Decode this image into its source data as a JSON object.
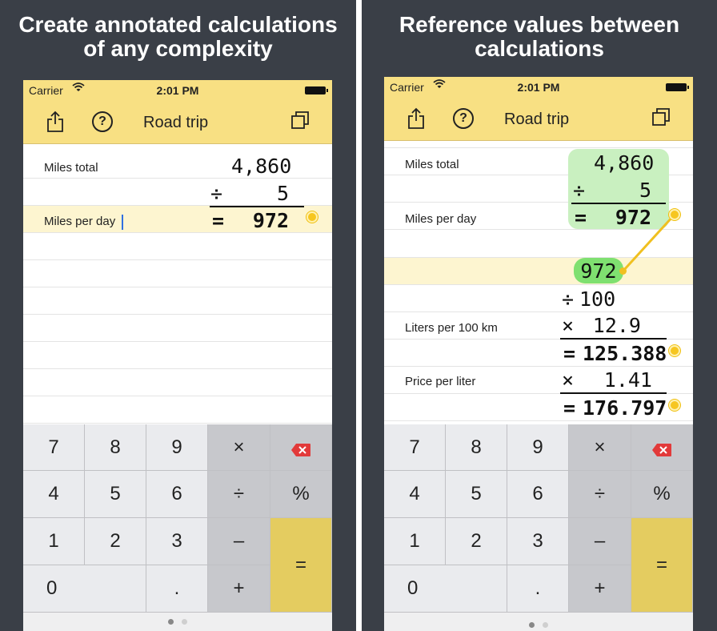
{
  "left": {
    "headline_line1": "Create annotated calculations",
    "headline_line2": "of any complexity",
    "status": {
      "carrier": "Carrier",
      "time": "2:01 PM"
    },
    "nav": {
      "title": "Road trip",
      "help": "?"
    },
    "rows": {
      "miles_total_label": "Miles total",
      "miles_total_value": "4,860",
      "op_divide": "÷",
      "divisor": "5",
      "miles_per_day_label": "Miles per day",
      "eq": "=",
      "result": "972"
    }
  },
  "right": {
    "headline_line1": "Reference values between",
    "headline_line2": "calculations",
    "status": {
      "carrier": "Carrier",
      "time": "2:01 PM"
    },
    "nav": {
      "title": "Road trip",
      "help": "?"
    },
    "rows": {
      "miles_total_label": "Miles total",
      "miles_total_value": "4,860",
      "op_divide": "÷",
      "divisor": "5",
      "miles_per_day_label": "Miles per day",
      "eq": "=",
      "result": "972",
      "ref_value": "972",
      "op_divide2": "÷",
      "hundred": "100",
      "liters_label": "Liters per 100 km",
      "op_times": "×",
      "liters_value": "12.9",
      "liters_result": "125.388",
      "price_label": "Price per liter",
      "op_times2": "×",
      "price_value": "1.41",
      "price_result": "176.797"
    }
  },
  "keypad": {
    "k7": "7",
    "k8": "8",
    "k9": "9",
    "times": "×",
    "k4": "4",
    "k5": "5",
    "k6": "6",
    "divide": "÷",
    "percent": "%",
    "k1": "1",
    "k2": "2",
    "k3": "3",
    "minus": "–",
    "k0": "0",
    "dot": ".",
    "plus": "+",
    "equals": "="
  },
  "colors": {
    "background": "#3a3f47",
    "bar_yellow": "#f8e083",
    "highlight_row": "#fdf5d0",
    "equals_key": "#e4cc60",
    "operator_key": "#c7c8cc",
    "reference_green": "#c9f0c0",
    "reference_pill": "#7fe070",
    "link_dot": "#f6c620",
    "backspace_red": "#e23a3a"
  },
  "icons": [
    "share-icon",
    "help-icon",
    "copy-icon",
    "wifi-icon",
    "battery-icon",
    "backspace-icon",
    "link-dot-icon"
  ]
}
